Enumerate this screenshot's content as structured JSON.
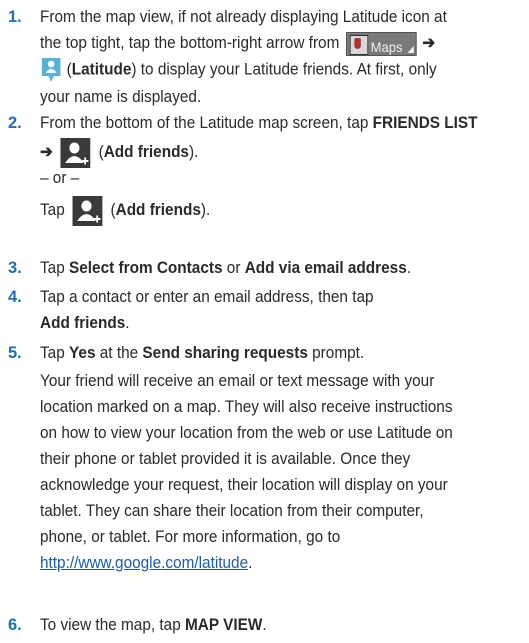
{
  "steps": [
    {
      "num": "1.",
      "l1a": "From the map view, if not already displaying Latitude icon at",
      "l2a": "the top tight, tap the bottom-right arrow from",
      "maps_label": "Maps",
      "arrow": "➔",
      "l3_bold": "Latitude",
      "l3b": ") to display your Latitude friends. At first, only",
      "l4": "your name is displayed."
    },
    {
      "num": "2.",
      "l1a": "From the bottom of the Latitude map screen, tap",
      "l1_bold": "FRIENDS LIST",
      "arrow": "➔",
      "l2_bold": "Add friends",
      "or_text": "– or –",
      "tap": "Tap",
      "l4_bold": "Add friends"
    },
    {
      "num": "3.",
      "tap": "Tap",
      "opt1": "Select from Contacts",
      "or": "or",
      "opt2": "Add via email address"
    },
    {
      "num": "4.",
      "l1": "Tap a contact or enter an email address, then tap",
      "l2_bold": "Add friends"
    },
    {
      "num": "5.",
      "tap": "Tap",
      "yes": "Yes",
      "at_the": "at the",
      "prompt_name": "Send sharing requests",
      "prompt_word": "prompt.",
      "para": [
        "Your friend will receive an email or text message with your",
        "location marked on a map. They will also receive instructions",
        "on how to view your location from the web or use Latitude on",
        "their phone or tablet provided it is available. Once they",
        "acknowledge your request, their location will display on your",
        "tablet. They can share their location from their computer,",
        "phone, or tablet. For more information, go to"
      ],
      "link": "http://www.google.com/latitude"
    },
    {
      "num": "6.",
      "text": "To view the map, tap",
      "bold": "MAP VIEW"
    }
  ],
  "colors": {
    "step_number": "#1e6fb3",
    "body_text": "#2a2a2a",
    "link": "#1e5aa8",
    "latitude_icon": "#57b3d6"
  },
  "icons": [
    "maps-button-icon",
    "latitude-icon",
    "add-friends-icon"
  ]
}
